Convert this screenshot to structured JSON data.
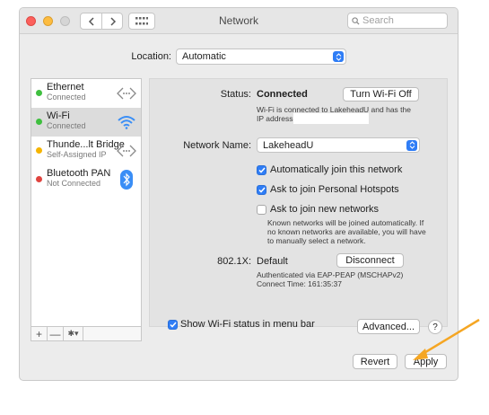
{
  "window": {
    "title": "Network",
    "search_placeholder": "Search"
  },
  "location": {
    "label": "Location:",
    "value": "Automatic"
  },
  "services": [
    {
      "name": "Ethernet",
      "status": "Connected",
      "dot_color": "#3fbf3f",
      "icon": "ethernet-arrows-icon"
    },
    {
      "name": "Wi-Fi",
      "status": "Connected",
      "dot_color": "#3fbf3f",
      "icon": "wifi-icon"
    },
    {
      "name": "Thunde...lt Bridge",
      "status": "Self-Assigned IP",
      "dot_color": "#f5b400",
      "icon": "bridge-arrows-icon"
    },
    {
      "name": "Bluetooth PAN",
      "status": "Not Connected",
      "dot_color": "#e0443f",
      "icon": "bluetooth-icon"
    }
  ],
  "sidebar_tools": {
    "add": "+",
    "remove": "—",
    "action": "✱▾"
  },
  "detail": {
    "status_label": "Status:",
    "status_value": "Connected",
    "turn_off_button": "Turn Wi-Fi Off",
    "status_desc_1": "Wi-Fi is connected to LakeheadU and has the",
    "status_desc_2": "IP address",
    "network_name_label": "Network Name:",
    "network_name_value": "LakeheadU",
    "auto_join": {
      "label": "Automatically join this network",
      "checked": true
    },
    "personal_hotspots": {
      "label": "Ask to join Personal Hotspots",
      "checked": true
    },
    "new_networks": {
      "label": "Ask to join new networks",
      "checked": false
    },
    "new_networks_desc_1": "Known networks will be joined automatically. If",
    "new_networks_desc_2": "no known networks are available, you will have",
    "new_networks_desc_3": "to manually select a network.",
    "dot1x_label": "802.1X:",
    "dot1x_value": "Default",
    "disconnect_button": "Disconnect",
    "auth_line_1": "Authenticated via EAP-PEAP (MSCHAPv2)",
    "auth_line_2": "Connect Time: 161:35:37"
  },
  "bottom": {
    "show_status": {
      "label": "Show Wi-Fi status in menu bar",
      "checked": true
    },
    "advanced_button": "Advanced...",
    "help_button": "?",
    "revert_button": "Revert",
    "apply_button": "Apply"
  },
  "colors": {
    "accent": "#2f7df6",
    "annotation_arrow": "#f5a623"
  }
}
